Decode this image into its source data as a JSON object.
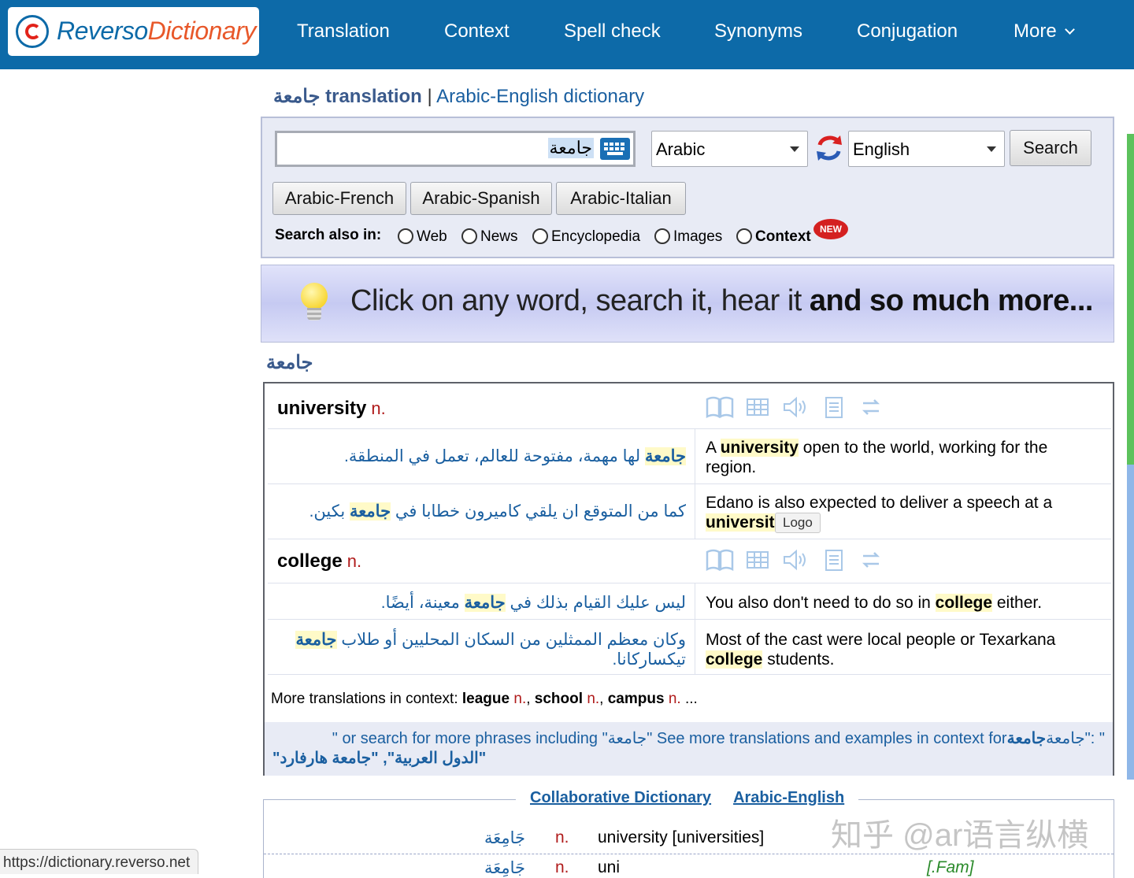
{
  "app": {
    "logo_part1": "Reverso",
    "logo_part2": "Dictionary"
  },
  "nav": {
    "items": [
      "Translation",
      "Context",
      "Spell check",
      "Synonyms",
      "Conjugation",
      "More"
    ]
  },
  "page_heading": {
    "word": "جامعة",
    "translation_word": "translation",
    "separator": "|",
    "dictionary": "Arabic-English dictionary"
  },
  "search": {
    "input_value": "جامعة",
    "source_lang": "Arabic",
    "target_lang": "English",
    "search_button": "Search",
    "quick_pairs": [
      "Arabic-French",
      "Arabic-Spanish",
      "Arabic-Italian"
    ],
    "search_also_label": "Search also in:",
    "search_also_options": [
      "Web",
      "News",
      "Encyclopedia",
      "Images",
      "Context"
    ],
    "new_badge": "NEW"
  },
  "banner": {
    "text_normal": "Click on any word,  search it, hear it ",
    "text_bold": "and so much more..."
  },
  "entry": {
    "headword": "جامعة",
    "senses": [
      {
        "word": "university",
        "pos": "n.",
        "examples": [
          {
            "ar_pre": "",
            "ar_hl": "جامعة",
            "ar_post": " لها مهمة، مفتوحة للعالم، تعمل في المنطقة.",
            "en_pre": "A ",
            "en_hl": "university",
            "en_post": " open to the world, working for the region."
          },
          {
            "ar_pre": "كما من المتوقع ان يلقي كاميرون خطابا في ",
            "ar_hl": "جامعة",
            "ar_post": " بكين.",
            "en_pre": "Edano is also expected to deliver a speech at a ",
            "en_hl": "universit",
            "en_post": ""
          }
        ]
      },
      {
        "word": "college",
        "pos": "n.",
        "examples": [
          {
            "ar_pre": "ليس عليك القيام بذلك في ",
            "ar_hl": "جامعة",
            "ar_post": " معينة، أيضًا.",
            "en_pre": "You also don't need to do so in ",
            "en_hl": "college",
            "en_post": " either."
          },
          {
            "ar_pre": "وكان معظم الممثلين من السكان المحليين أو طلاب ",
            "ar_hl": "جامعة",
            "ar_post": " تيكساركانا.",
            "en_pre": "Most of the cast were local people or Texarkana ",
            "en_hl": "college",
            "en_post": " students."
          }
        ]
      }
    ],
    "tooltip": "Logo",
    "more_label": "More translations in context: ",
    "more_items": [
      {
        "word": "league",
        "pos": "n."
      },
      {
        "word": "school",
        "pos": "n."
      },
      {
        "word": "campus",
        "pos": "n."
      }
    ],
    "more_ellipsis": " ...",
    "see_more_line1": "See more translations and examples in context for \"جامعة\" or search for more phrases including \"",
    "see_more_hl": "جامعة",
    "see_more_line1_end": "\" :\"جامعة",
    "see_more_line2": "\"الدول العربية\", \"جامعة هارفارد\""
  },
  "collab": {
    "title_a": "Collaborative Dictionary",
    "title_b": "Arabic-English",
    "rows": [
      {
        "ar": "جَامِعَة",
        "pos": "n.",
        "tr": "university [universities]",
        "reg": ""
      },
      {
        "ar": "جَامِعَة",
        "pos": "n.",
        "tr": "uni",
        "reg": "[.Fam]"
      }
    ]
  },
  "status_url": "https://dictionary.reverso.net",
  "watermark": "知乎 @ar语言纵横",
  "colors": {
    "brand_blue": "#0d6aa8",
    "accent_red": "#e8582a",
    "link_blue": "#1a5fa0"
  },
  "icons": [
    "book-icon",
    "table-icon",
    "speaker-icon",
    "notes-icon",
    "swap-icon"
  ]
}
